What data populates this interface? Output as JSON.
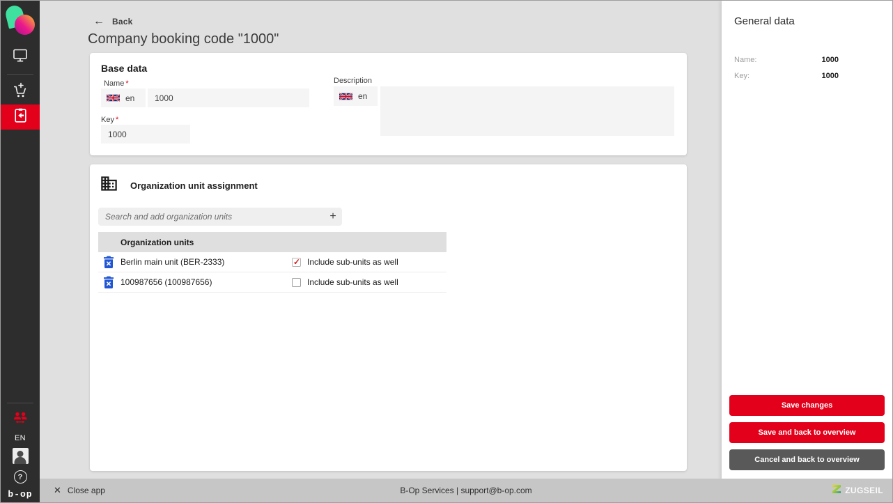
{
  "colors": {
    "accent_red": "#e2001a",
    "delete_blue": "#2156d4",
    "check_red": "#d21f1f",
    "sidebar_dark": "#2d2d2d"
  },
  "icons": {
    "back_arrow": "←",
    "close_x": "✕",
    "add_plus": "+",
    "help_mark": "?"
  },
  "sidebar": {
    "language": "EN",
    "brand": "b-op"
  },
  "header": {
    "back_label": "Back",
    "title": "Company booking code \"1000\""
  },
  "base_data": {
    "section_title": "Base data",
    "name_label": "Name",
    "required_marker": "*",
    "name_lang": "en",
    "name_value": "1000",
    "description_label": "Description",
    "description_lang": "en",
    "description_value": "",
    "key_label": "Key",
    "key_value": "1000"
  },
  "org_assignment": {
    "section_title": "Organization unit assignment",
    "search_placeholder": "Search and add organization units",
    "table": {
      "header": "Organization units",
      "rows": [
        {
          "name": "Berlin main unit (BER-2333)",
          "include_label": "Include sub-units as well",
          "include_checked": true
        },
        {
          "name": "100987656 (100987656)",
          "include_label": "Include sub-units as well",
          "include_checked": false
        }
      ]
    }
  },
  "general_data": {
    "title": "General data",
    "name_label": "Name:",
    "name_value": "1000",
    "key_label": "Key:",
    "key_value": "1000",
    "buttons": {
      "save": "Save changes",
      "save_back": "Save and back to overview",
      "cancel_back": "Cancel and back to overview"
    }
  },
  "footer": {
    "close_label": "Close app",
    "center_text": "B-Op Services | support@b-op.com",
    "brand": "ZUGSEIL"
  }
}
